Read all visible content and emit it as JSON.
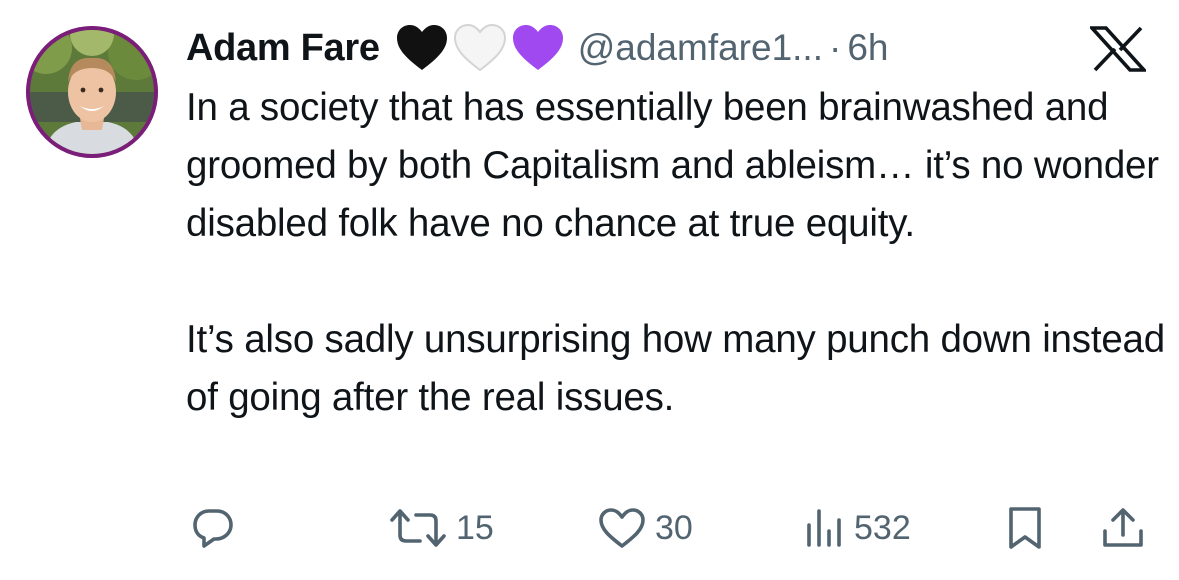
{
  "author": {
    "name": "Adam Fare",
    "handle": "@adamfare1...",
    "separator": "·",
    "time": "6h",
    "badges": [
      "black-heart-icon",
      "white-heart-icon",
      "purple-heart-icon"
    ]
  },
  "tweet": {
    "paragraphs": [
      "In a society that has essentially been brainwashed and groomed by both Capitalism and ableism… it’s no wonder disabled folk have no chance at true equity.",
      "It’s also sadly unsurprising how many punch down instead of going after the real issues."
    ]
  },
  "actions": {
    "reply": {
      "icon": "reply-icon",
      "count": ""
    },
    "retweet": {
      "icon": "retweet-icon",
      "count": "15"
    },
    "like": {
      "icon": "heart-icon",
      "count": "30"
    },
    "views": {
      "icon": "views-icon",
      "count": "532"
    },
    "bookmark": {
      "icon": "bookmark-icon"
    },
    "share": {
      "icon": "share-icon"
    }
  },
  "brand": {
    "logo": "x-logo-icon"
  },
  "colors": {
    "text": "#0f1419",
    "muted": "#536471",
    "purple_heart": "#a149f0",
    "avatar_ring": "#7b1e7a"
  }
}
